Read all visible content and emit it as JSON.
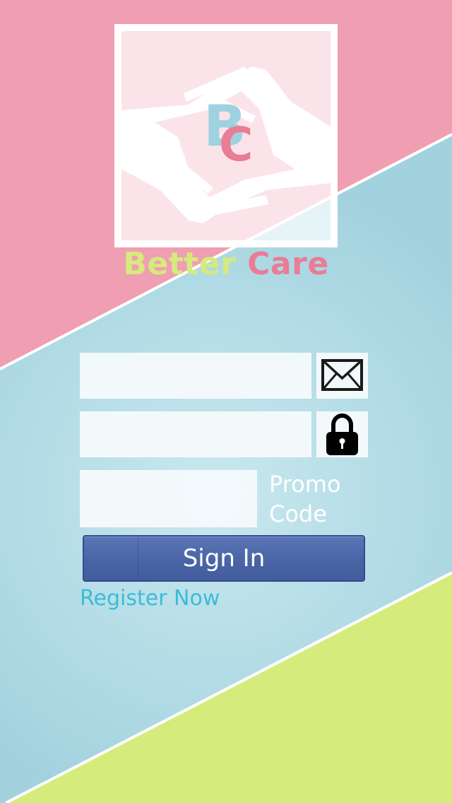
{
  "logo": {
    "monogram_b": "B",
    "monogram_c": "C",
    "brand_word1": "Better",
    "brand_word2": "Care"
  },
  "form": {
    "email_value": "",
    "email_icon": "envelope-icon",
    "password_value": "",
    "password_icon": "padlock-icon",
    "promo_value": "",
    "promo_label": "Promo Code",
    "signin_label": "Sign In",
    "register_label": "Register Now"
  },
  "colors": {
    "background_top": "#ef9fb1",
    "background_middle": "#a3d3df",
    "background_bottom": "#d5ec7c",
    "brand_better": "#d6ea7d",
    "brand_care": "#e87d95",
    "signin_button": "#4a65a6",
    "register_link": "#3bbcd9"
  }
}
